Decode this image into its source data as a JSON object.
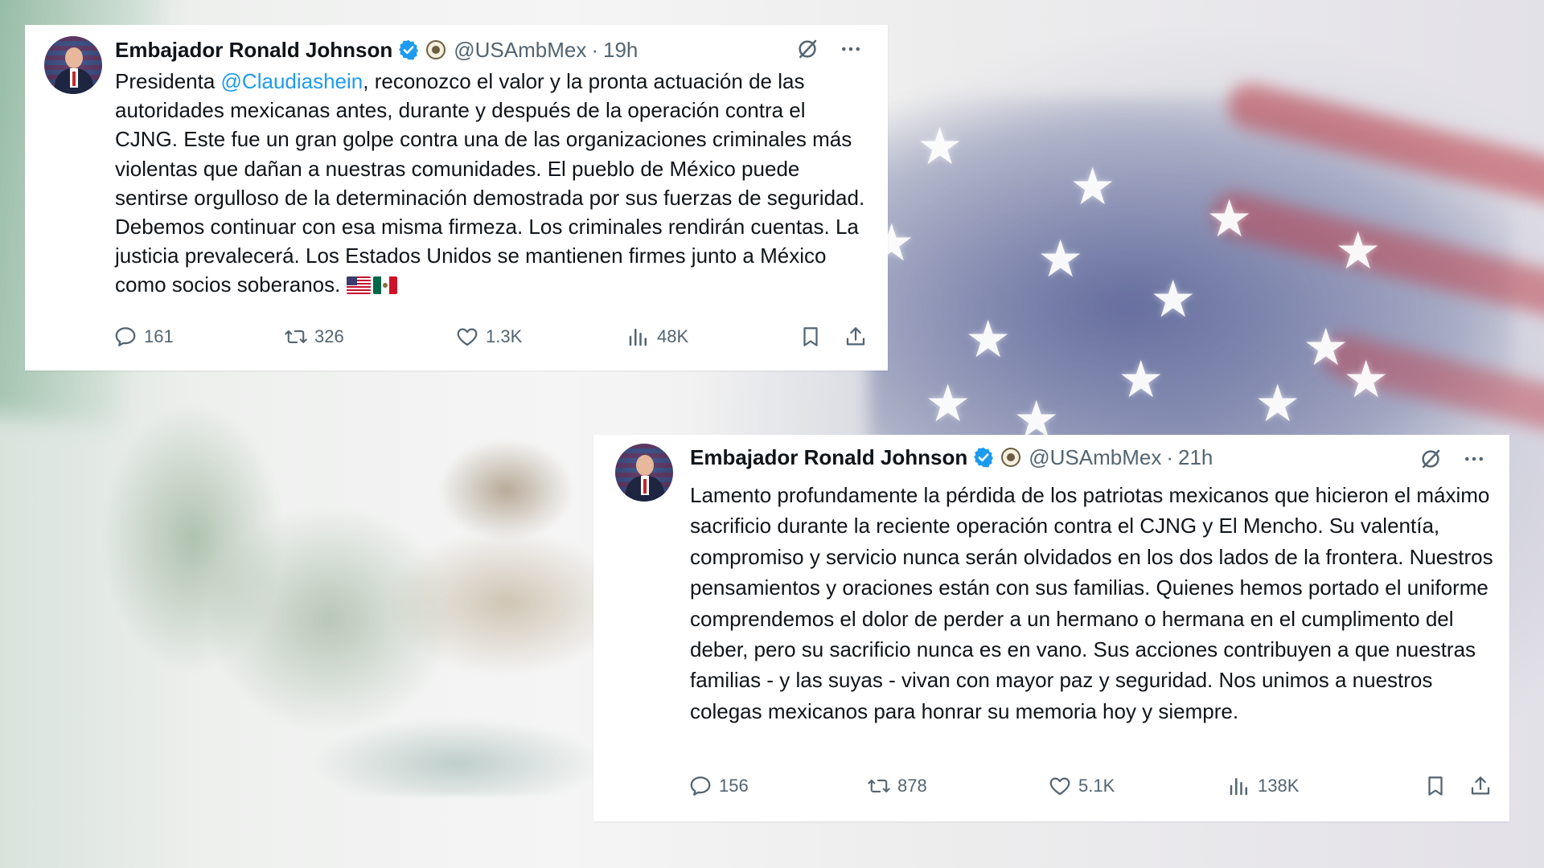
{
  "colors": {
    "text": "#0f1419",
    "secondary": "#536471",
    "link": "#1d9bf0",
    "verified": "#1d9bf0"
  },
  "tweets": [
    {
      "display_name": "Embajador Ronald Johnson",
      "handle": "@USAmbMex",
      "separator": "·",
      "time": "19h",
      "text_before_mention": "Presidenta ",
      "mention": "@Claudiashein",
      "text_after_mention": ", reconozco el valor y la pronta actuación de las autoridades mexicanas antes, durante y después de la operación contra el CJNG. Este fue un gran golpe contra una de las organizaciones criminales más violentas que dañan a nuestras comunidades. El pueblo de México puede sentirse orgulloso de la determinación demostrada por sus fuerzas de seguridad. Debemos continuar con esa misma firmeza. Los criminales rendirán cuentas. La justicia prevalecerá. Los Estados Unidos se mantienen firmes junto a México como socios soberanos. ",
      "emojis": [
        "us-flag",
        "mexico-flag"
      ],
      "stats": {
        "replies": "161",
        "reposts": "326",
        "likes": "1.3K",
        "views": "48K"
      }
    },
    {
      "display_name": "Embajador Ronald Johnson",
      "handle": "@USAmbMex",
      "separator": "·",
      "time": "21h",
      "text": "Lamento profundamente la pérdida de los patriotas mexicanos que hicieron el máximo sacrificio durante la reciente operación contra el CJNG y El Mencho. Su valentía, compromiso y servicio nunca serán olvidados en los dos lados de la frontera. Nuestros pensamientos y oraciones están con sus familias. Quienes hemos portado el uniforme comprendemos el dolor de perder a un hermano o hermana en el cumplimento del deber, pero su sacrificio nunca es en vano.  Sus acciones contribuyen a que nuestras familias - y las suyas - vivan con mayor paz y seguridad. Nos unimos a nuestros colegas mexicanos para honrar su memoria hoy y siempre.",
      "stats": {
        "replies": "156",
        "reposts": "878",
        "likes": "5.1K",
        "views": "138K"
      }
    }
  ]
}
